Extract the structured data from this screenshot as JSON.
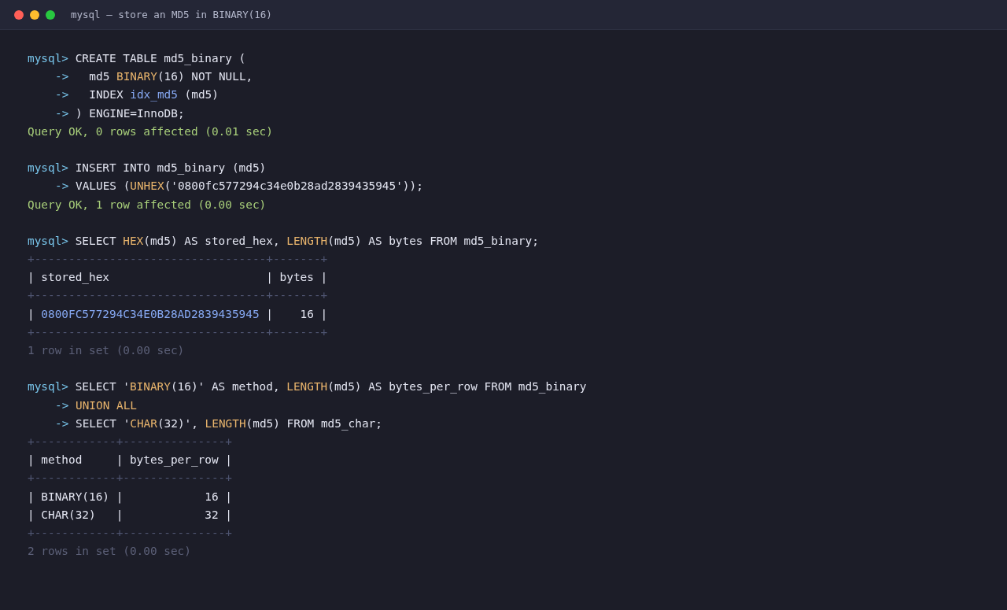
{
  "window": {
    "title": "mysql — store an MD5 in BINARY(16)"
  },
  "lines": [
    {
      "kind": "command",
      "prompt": "mysql>",
      "segments": [
        {
          "text": "CREATE TABLE md5_binary (",
          "kind": "plain"
        }
      ]
    },
    {
      "kind": "continuation",
      "prompt": "->",
      "segments": [
        {
          "text": "  md5 ",
          "kind": "plain"
        },
        {
          "text": "BINARY",
          "kind": "func"
        },
        {
          "text": "(16) NOT NULL,",
          "kind": "plain"
        }
      ]
    },
    {
      "kind": "continuation",
      "prompt": "->",
      "segments": [
        {
          "text": "  INDEX ",
          "kind": "plain"
        },
        {
          "text": "idx_md5",
          "kind": "ident"
        },
        {
          "text": " (md5)",
          "kind": "plain"
        }
      ]
    },
    {
      "kind": "continuation",
      "prompt": "->",
      "segments": [
        {
          "text": ") ENGINE=InnoDB;",
          "kind": "plain"
        }
      ]
    },
    {
      "kind": "ok",
      "segments": [
        {
          "text": "Query OK, 0 rows affected (0.01 sec)",
          "kind": "ok"
        }
      ]
    },
    {
      "kind": "blank"
    },
    {
      "kind": "command",
      "prompt": "mysql>",
      "segments": [
        {
          "text": "INSERT INTO md5_binary (md5)",
          "kind": "plain"
        }
      ]
    },
    {
      "kind": "continuation",
      "prompt": "->",
      "segments": [
        {
          "text": "VALUES (",
          "kind": "plain"
        },
        {
          "text": "UNHEX",
          "kind": "func"
        },
        {
          "text": "('0800fc577294c34e0b28ad2839435945'));",
          "kind": "plain"
        }
      ]
    },
    {
      "kind": "ok",
      "segments": [
        {
          "text": "Query OK, 1 row affected (0.00 sec)",
          "kind": "ok"
        }
      ]
    },
    {
      "kind": "blank"
    },
    {
      "kind": "command",
      "prompt": "mysql>",
      "segments": [
        {
          "text": "SELECT ",
          "kind": "plain"
        },
        {
          "text": "HEX",
          "kind": "func"
        },
        {
          "text": "(md5) AS stored_hex, ",
          "kind": "plain"
        },
        {
          "text": "LENGTH",
          "kind": "func"
        },
        {
          "text": "(md5) AS bytes FROM md5_binary;",
          "kind": "plain"
        }
      ]
    },
    {
      "kind": "border",
      "segments": [
        {
          "text": "+----------------------------------+-------+",
          "kind": "border"
        }
      ]
    },
    {
      "kind": "row",
      "segments": [
        {
          "text": "| stored_hex                       | bytes |",
          "kind": "plain"
        }
      ]
    },
    {
      "kind": "border",
      "segments": [
        {
          "text": "+----------------------------------+-------+",
          "kind": "border"
        }
      ]
    },
    {
      "kind": "row",
      "segments": [
        {
          "text": "| ",
          "kind": "plain"
        },
        {
          "text": "0800FC577294C34E0B28AD2839435945",
          "kind": "ident"
        },
        {
          "text": " |    16 |",
          "kind": "plain"
        }
      ]
    },
    {
      "kind": "border",
      "segments": [
        {
          "text": "+----------------------------------+-------+",
          "kind": "border"
        }
      ]
    },
    {
      "kind": "info",
      "segments": [
        {
          "text": "1 row in set (0.00 sec)",
          "kind": "dim"
        }
      ]
    },
    {
      "kind": "blank"
    },
    {
      "kind": "command",
      "prompt": "mysql>",
      "segments": [
        {
          "text": "SELECT '",
          "kind": "plain"
        },
        {
          "text": "BINARY",
          "kind": "func"
        },
        {
          "text": "(16)' AS method, ",
          "kind": "plain"
        },
        {
          "text": "LENGTH",
          "kind": "func"
        },
        {
          "text": "(md5) AS bytes_per_row FROM md5_binary",
          "kind": "plain"
        }
      ]
    },
    {
      "kind": "continuation",
      "prompt": "->",
      "segments": [
        {
          "text": "UNION ALL",
          "kind": "func"
        }
      ]
    },
    {
      "kind": "continuation",
      "prompt": "->",
      "segments": [
        {
          "text": "SELECT '",
          "kind": "plain"
        },
        {
          "text": "CHAR",
          "kind": "func"
        },
        {
          "text": "(32)', ",
          "kind": "plain"
        },
        {
          "text": "LENGTH",
          "kind": "func"
        },
        {
          "text": "(md5) FROM md5_char;",
          "kind": "plain"
        }
      ]
    },
    {
      "kind": "border",
      "segments": [
        {
          "text": "+------------+---------------+",
          "kind": "border"
        }
      ]
    },
    {
      "kind": "row",
      "segments": [
        {
          "text": "| method     | bytes_per_row |",
          "kind": "plain"
        }
      ]
    },
    {
      "kind": "border",
      "segments": [
        {
          "text": "+------------+---------------+",
          "kind": "border"
        }
      ]
    },
    {
      "kind": "row",
      "segments": [
        {
          "text": "| BINARY(16) |            16 |",
          "kind": "plain"
        }
      ]
    },
    {
      "kind": "row",
      "segments": [
        {
          "text": "| CHAR(32)   |            32 |",
          "kind": "plain"
        }
      ]
    },
    {
      "kind": "border",
      "segments": [
        {
          "text": "+------------+---------------+",
          "kind": "border"
        }
      ]
    },
    {
      "kind": "info",
      "segments": [
        {
          "text": "2 rows in set (0.00 sec)",
          "kind": "dim"
        }
      ]
    }
  ]
}
